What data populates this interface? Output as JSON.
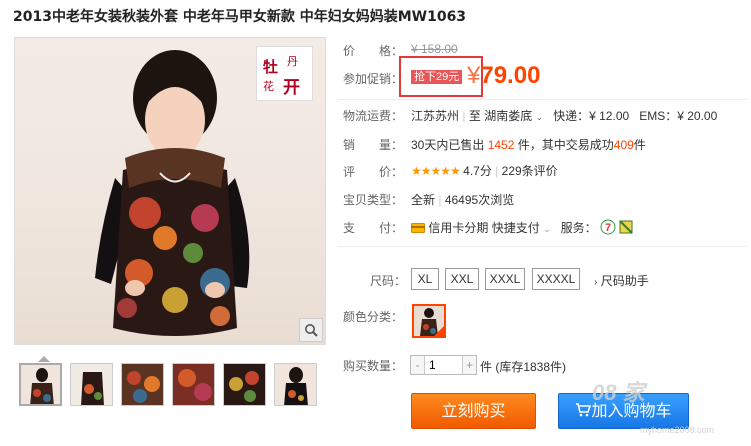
{
  "product": {
    "title": "2013中老年女装秋装外套 中老年马甲女新款 中年妇女妈妈装MW1063"
  },
  "stamp": {
    "s1": "牡",
    "s2": "丹",
    "s3": "花",
    "s4": "开"
  },
  "price": {
    "label": "价　　格：",
    "original": "¥ 158.00",
    "promo_label": "参加促销：",
    "promo_tag": "抢下29元",
    "current_symbol": "¥",
    "current": "79.00"
  },
  "shipping": {
    "label": "物流运费：",
    "from": "江苏苏州",
    "sep": "|",
    "to_prefix": "至",
    "to": "湖南娄底",
    "express_label": "快递：",
    "express_price": "¥ 12.00",
    "ems_label": "EMS：",
    "ems_price": "¥ 20.00"
  },
  "sales": {
    "label": "销　　量：",
    "prefix": "30天内已售出",
    "count": "1452",
    "mid": "件，其中交易成功",
    "success": "409",
    "suffix": "件"
  },
  "rating": {
    "label": "评　　价：",
    "stars": "★★★★★",
    "score": "4.7分",
    "sep": "|",
    "count": "229条评价"
  },
  "item_type": {
    "label": "宝贝类型：",
    "value": "全新",
    "sep": "|",
    "views": "46495次浏览"
  },
  "payment": {
    "label": "支　　付：",
    "credit": "信用卡分期",
    "quick": "快捷支付",
    "service_label": "服务："
  },
  "sizes": {
    "label": "尺码：",
    "options": [
      "XL",
      "XXL",
      "XXXL",
      "XXXXL"
    ],
    "helper": "尺码助手"
  },
  "color": {
    "label": "颜色分类："
  },
  "quantity": {
    "label": "购买数量：",
    "value": "1",
    "stock": "件 (库存1838件)"
  },
  "actions": {
    "buy": "立刻购买",
    "cart": "加入购物车"
  },
  "watermark": {
    "text": "08 家",
    "sub": "myhome2008.com"
  },
  "colors": {
    "accent": "#ff4400",
    "buy": "#f05a00",
    "cart": "#1677e6"
  }
}
